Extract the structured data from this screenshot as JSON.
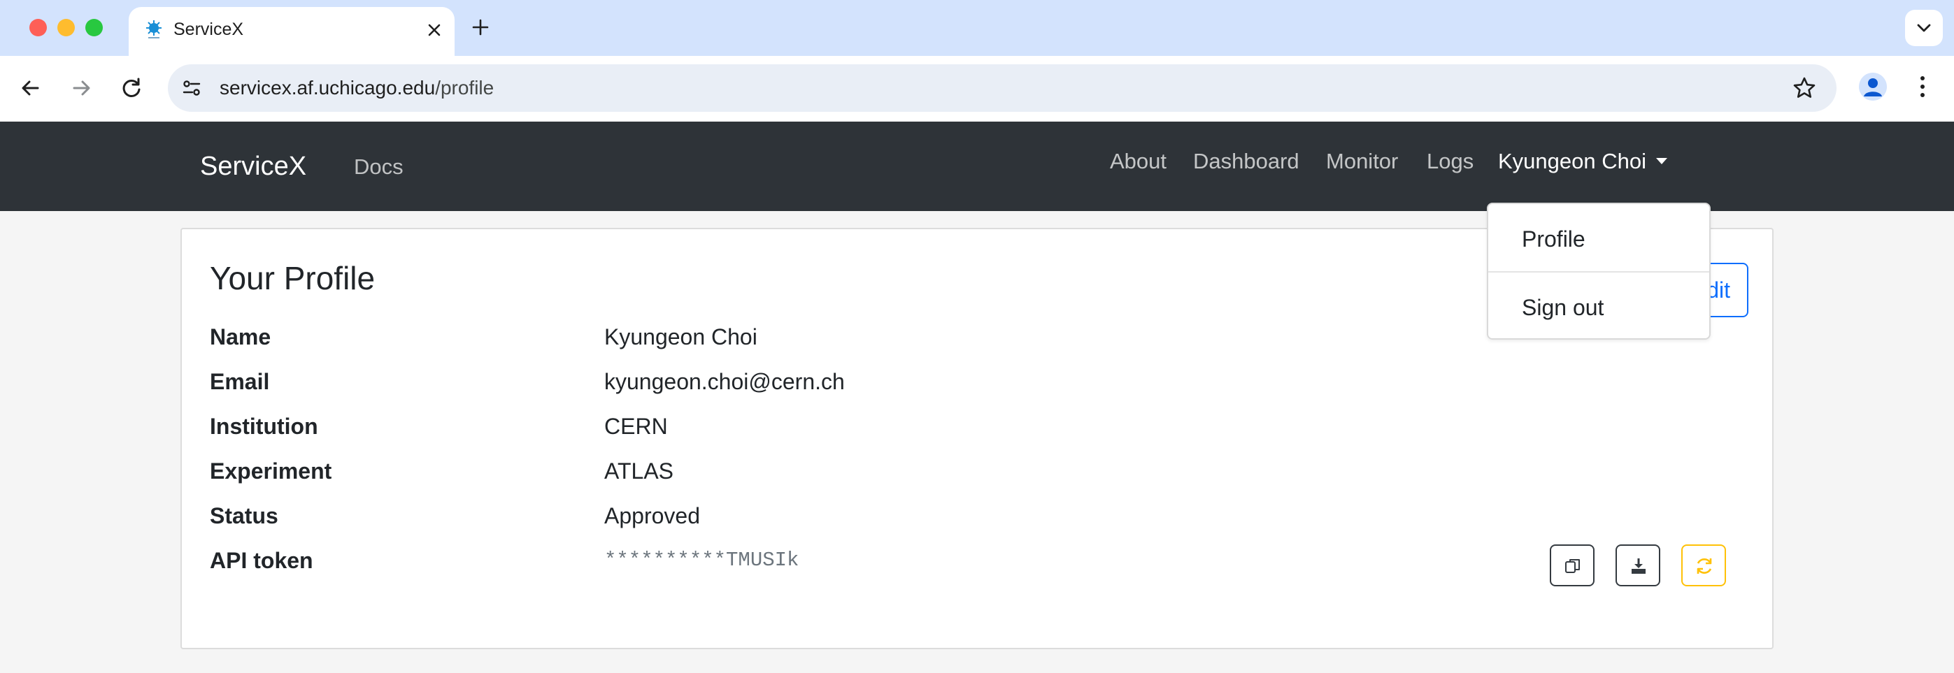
{
  "browser": {
    "tab_title": "ServiceX",
    "url_host": "servicex.af.uchicago.edu",
    "url_path": "/profile"
  },
  "navbar": {
    "brand": "ServiceX",
    "docs": "Docs",
    "about": "About",
    "dashboard": "Dashboard",
    "monitor": "Monitor",
    "logs": "Logs",
    "user_menu": "Kyungeon Choi"
  },
  "dropdown": {
    "profile": "Profile",
    "sign_out": "Sign out"
  },
  "profile": {
    "title": "Your Profile",
    "edit_label": "Edit",
    "fields": [
      {
        "label": "Name",
        "value": "Kyungeon Choi"
      },
      {
        "label": "Email",
        "value": "kyungeon.choi@cern.ch"
      },
      {
        "label": "Institution",
        "value": "CERN"
      },
      {
        "label": "Experiment",
        "value": "ATLAS"
      },
      {
        "label": "Status",
        "value": "Approved"
      },
      {
        "label": "API token",
        "value": "**********TMUSIk"
      }
    ]
  },
  "icons": {
    "copy": "copy-icon",
    "download": "download-icon",
    "refresh": "refresh-icon"
  },
  "colors": {
    "navbar_bg": "#2e3338",
    "primary": "#0d6efd",
    "warning": "#ffc107",
    "tabbar_bg": "#d3e3fd"
  }
}
